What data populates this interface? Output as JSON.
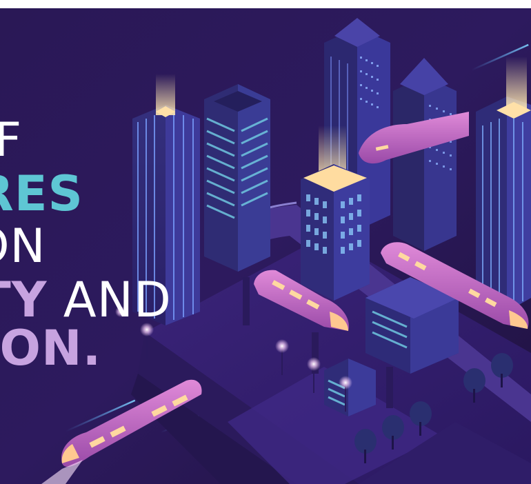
{
  "headline": {
    "line1": "F",
    "line2": "URES",
    "line3": "ON",
    "line4_part1": "TY",
    "line4_part2": "AND",
    "line5": "ATION."
  },
  "colors": {
    "background_dark": "#231446",
    "background_mid": "#3a2275",
    "text_white": "#ffffff",
    "text_teal": "#5ec6d4",
    "text_lilac": "#c7a3e0",
    "train_pink": "#c46cc4",
    "window_glow": "#ffd9a0",
    "building_blue": "#3c4fa8"
  }
}
